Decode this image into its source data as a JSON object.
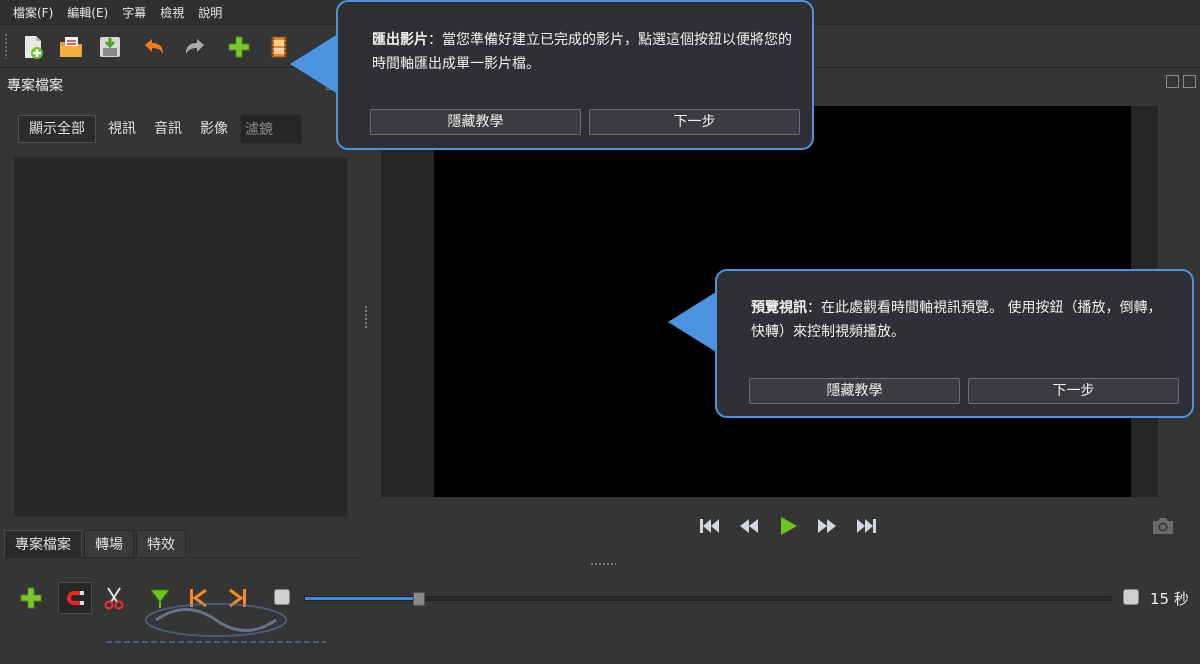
{
  "menu": [
    "檔案(F)",
    "編輯(E)",
    "字幕",
    "檢視",
    "說明"
  ],
  "toolbar": {
    "icons": [
      "new-project-icon",
      "open-project-icon",
      "save-project-icon",
      "undo-icon",
      "redo-icon",
      "import-files-icon",
      "export-video-icon"
    ]
  },
  "project_panel": {
    "title": "專案檔案",
    "filters": [
      "顯示全部",
      "視訊",
      "音訊",
      "影像"
    ],
    "filter_placeholder": "濾鏡",
    "tabs": [
      "專案檔案",
      "轉場",
      "特效"
    ]
  },
  "timeline": {
    "zoom_label": "15 秒",
    "zoom_fraction": 0.14
  },
  "tips": {
    "export": {
      "title": "匯出影片",
      "body": "：當您準備好建立已完成的影片，點選這個按鈕以便將您的時間軸匯出成單一影片檔。",
      "hide": "隱藏教學",
      "next": "下一步"
    },
    "preview": {
      "title": "預覽視訊",
      "body": "：在此處觀看時間軸視訊預覽。 使用按鈕（播放，倒轉，快轉）來控制視頻播放。",
      "hide": "隱藏教學",
      "next": "下一步"
    }
  },
  "colors": {
    "accent": "#4c94e0",
    "background": "#353535",
    "green": "#7ec62e",
    "orange": "#f08a24"
  }
}
